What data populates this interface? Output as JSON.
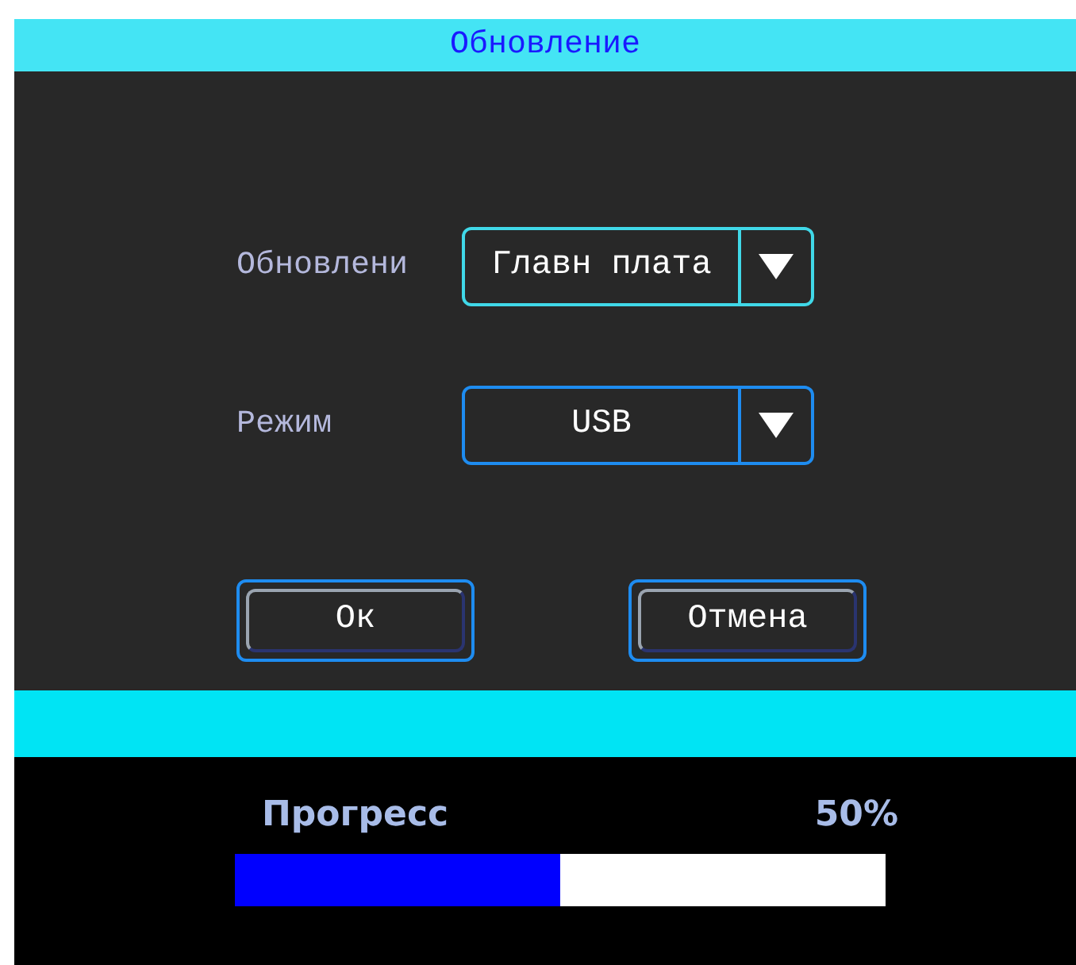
{
  "dialog": {
    "title": "Обновление",
    "fields": [
      {
        "label": "Обновлени",
        "value": "Главн плата",
        "selected": true
      },
      {
        "label": "Режим",
        "value": "USB",
        "selected": false
      }
    ],
    "buttons": [
      "Ок",
      "Отмена"
    ]
  },
  "progress": {
    "label": "Прогресс",
    "reading": "50%",
    "level": 0.5
  }
}
